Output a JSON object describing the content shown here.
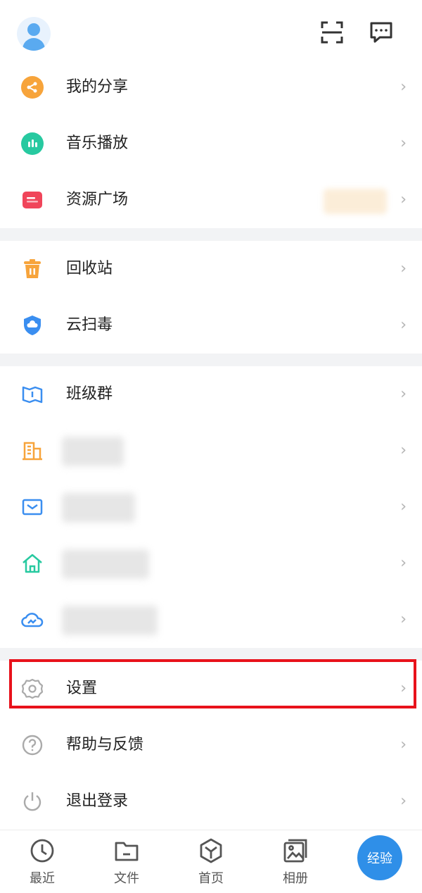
{
  "header": {
    "avatar_icon": "user-avatar-icon",
    "scan_icon": "scan-icon",
    "message_icon": "message-icon"
  },
  "section1": [
    {
      "label": "我的分享",
      "icon": "share-icon",
      "color": "#f7a43b"
    },
    {
      "label": "音乐播放",
      "icon": "music-icon",
      "color": "#27c9a0"
    },
    {
      "label": "资源广场",
      "icon": "resource-icon",
      "color": "#f0455a"
    }
  ],
  "section2": [
    {
      "label": "回收站",
      "icon": "trash-icon",
      "color": "#f7a43b"
    },
    {
      "label": "云扫毒",
      "icon": "shield-icon",
      "color": "#3a8ef0"
    }
  ],
  "section3": [
    {
      "label": "班级群",
      "icon": "book-icon",
      "color": "#3a8ef0"
    },
    {
      "label": "",
      "icon": "building-icon",
      "color": "#f7a43b"
    },
    {
      "label": "",
      "icon": "mail-icon",
      "color": "#3a8ef0"
    },
    {
      "label": "",
      "icon": "home-icon",
      "color": "#27c9a0"
    },
    {
      "label": "",
      "icon": "cloud-icon",
      "color": "#3a8ef0"
    }
  ],
  "section4": [
    {
      "label": "设置",
      "icon": "gear-icon",
      "color": "#aaaaaa"
    },
    {
      "label": "帮助与反馈",
      "icon": "help-icon",
      "color": "#aaaaaa"
    },
    {
      "label": "退出登录",
      "icon": "power-icon",
      "color": "#aaaaaa"
    }
  ],
  "chevron": "›",
  "tabs": [
    {
      "label": "最近",
      "icon": "clock-icon"
    },
    {
      "label": "文件",
      "icon": "folder-icon"
    },
    {
      "label": "首页",
      "icon": "home-hex-icon"
    },
    {
      "label": "相册",
      "icon": "album-icon"
    }
  ],
  "fab_label": "经验",
  "colors": {
    "accent": "#2f8fe8",
    "highlight": "#e8121b",
    "divider": "#f2f3f5"
  }
}
